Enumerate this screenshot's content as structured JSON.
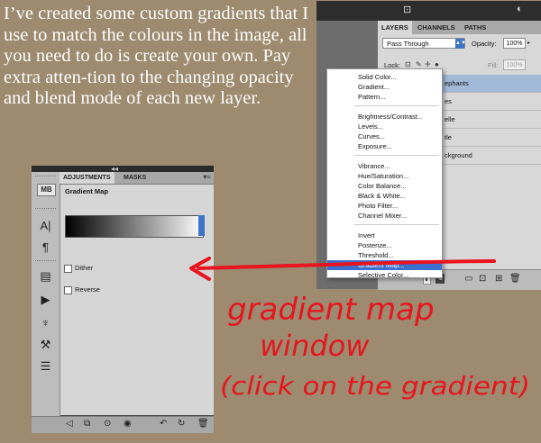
{
  "intro_text": "I’ve created some custom gradients that I use to match the colours in the image, all you need to do is create your own. Pay extra atten-tion to the changing opacity and blend mode of each new layer.",
  "adjustments_panel": {
    "collapse_glyph": "◂◂",
    "tabs": [
      "ADJUSTMENTS",
      "MASKS"
    ],
    "menu_glyph": "▾≡",
    "title": "Gradient Map",
    "checkboxes": [
      "Dither",
      "Reverse"
    ],
    "toolbar_icons": [
      "adjustment-layer-icon",
      "text-icon",
      "paragraph-icon",
      "clipboard-icon",
      "play-icon",
      "brush-tool-icon",
      "stamp-icon",
      "list-icon"
    ],
    "bottom_icons": [
      "back-arrow-icon",
      "expand-icon",
      "clip-icon",
      "eye-icon",
      "previous-state-icon",
      "reset-icon",
      "trash-icon"
    ]
  },
  "layers_panel": {
    "tabs": [
      "LAYERS",
      "CHANNELS",
      "PATHS"
    ],
    "blend_mode": "Pass Through",
    "opacity_label": "Opacity:",
    "opacity_value": "100%",
    "lock_label": "Lock:",
    "fill_label": "Fill:",
    "fill_value": "100%",
    "layer_names": [
      "ephants",
      "es",
      "elle",
      "tle",
      "ckground"
    ]
  },
  "popup_menu": {
    "groups": [
      [
        "Solid Color...",
        "Gradient...",
        "Pattern..."
      ],
      [
        "Brightness/Contrast...",
        "Levels...",
        "Curves...",
        "Exposure..."
      ],
      [
        "Vibrance...",
        "Hue/Saturation...",
        "Color Balance...",
        "Black & White...",
        "Photo Filter...",
        "Channel Mixer..."
      ],
      [
        "Invert",
        "Posterize...",
        "Threshold...",
        "Gradient Map...",
        "Selective Color..."
      ]
    ],
    "highlighted": "Gradient Map..."
  },
  "annotation": {
    "lines": [
      "gradient map",
      "window",
      "(click on the gradient)"
    ],
    "color": "#e8141e"
  }
}
